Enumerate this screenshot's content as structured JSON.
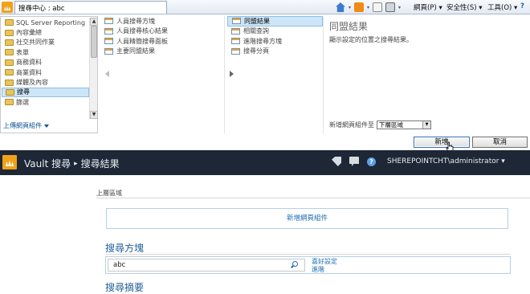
{
  "browser": {
    "tab_title": "搜尋中心 : abc",
    "menus": {
      "page": "網頁(P) ▾",
      "safety": "安全性(S) ▾",
      "tools": "工具(O) ▾",
      "help": "?"
    }
  },
  "gallery": {
    "categories": [
      "SQL Server Reporting",
      "內容彙總",
      "社交共同作業",
      "表單",
      "商務資料",
      "商業資料",
      "媒體及內容",
      "搜尋",
      "篩選"
    ],
    "selected_category": "搜尋",
    "upload_label": "上傳網頁組件",
    "parts_col1": [
      "人員搜尋方塊",
      "人員搜尋核心結果",
      "人員精簡搜尋面板",
      "主要同盟結果"
    ],
    "parts_col2": [
      "同盟結果",
      "相關查詢",
      "進階搜尋方塊",
      "搜尋分頁"
    ],
    "selected_part": "同盟結果",
    "about_title": "同盟結果",
    "about_desc": "顯示設定的位置之搜尋結果。",
    "add_to_label": "新增網頁組件至",
    "zone_value": "下層區域",
    "add_button": "新增",
    "cancel_button": "取消"
  },
  "suite": {
    "site": "Vault 搜尋",
    "sep": "▸",
    "page": "搜尋結果",
    "user": "SHEREPOINTCHT\\administrator ▾"
  },
  "content": {
    "zone_label": "上層區域",
    "add_web_part": "新增網頁組件",
    "search_box_title": "搜尋方塊",
    "search_value": "abc",
    "preferences": "喜好設定",
    "advanced": "進階",
    "summary_title": "搜尋摘要"
  }
}
